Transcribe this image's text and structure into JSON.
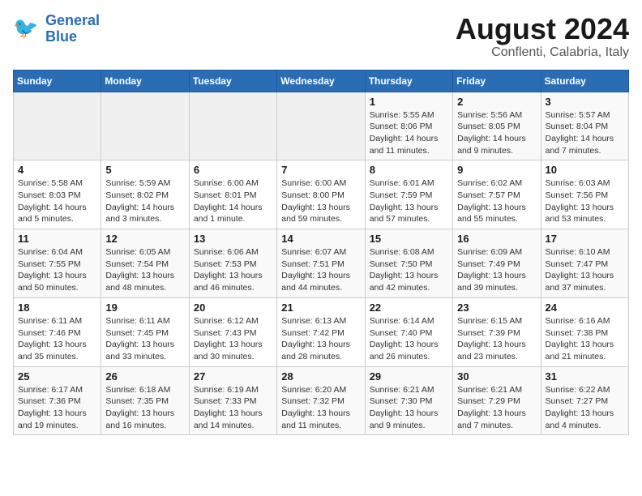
{
  "header": {
    "logo_line1": "General",
    "logo_line2": "Blue",
    "title": "August 2024",
    "subtitle": "Conflenti, Calabria, Italy"
  },
  "weekdays": [
    "Sunday",
    "Monday",
    "Tuesday",
    "Wednesday",
    "Thursday",
    "Friday",
    "Saturday"
  ],
  "weeks": [
    [
      {
        "day": "",
        "info": ""
      },
      {
        "day": "",
        "info": ""
      },
      {
        "day": "",
        "info": ""
      },
      {
        "day": "",
        "info": ""
      },
      {
        "day": "1",
        "info": "Sunrise: 5:55 AM\nSunset: 8:06 PM\nDaylight: 14 hours\nand 11 minutes."
      },
      {
        "day": "2",
        "info": "Sunrise: 5:56 AM\nSunset: 8:05 PM\nDaylight: 14 hours\nand 9 minutes."
      },
      {
        "day": "3",
        "info": "Sunrise: 5:57 AM\nSunset: 8:04 PM\nDaylight: 14 hours\nand 7 minutes."
      }
    ],
    [
      {
        "day": "4",
        "info": "Sunrise: 5:58 AM\nSunset: 8:03 PM\nDaylight: 14 hours\nand 5 minutes."
      },
      {
        "day": "5",
        "info": "Sunrise: 5:59 AM\nSunset: 8:02 PM\nDaylight: 14 hours\nand 3 minutes."
      },
      {
        "day": "6",
        "info": "Sunrise: 6:00 AM\nSunset: 8:01 PM\nDaylight: 14 hours\nand 1 minute."
      },
      {
        "day": "7",
        "info": "Sunrise: 6:00 AM\nSunset: 8:00 PM\nDaylight: 13 hours\nand 59 minutes."
      },
      {
        "day": "8",
        "info": "Sunrise: 6:01 AM\nSunset: 7:59 PM\nDaylight: 13 hours\nand 57 minutes."
      },
      {
        "day": "9",
        "info": "Sunrise: 6:02 AM\nSunset: 7:57 PM\nDaylight: 13 hours\nand 55 minutes."
      },
      {
        "day": "10",
        "info": "Sunrise: 6:03 AM\nSunset: 7:56 PM\nDaylight: 13 hours\nand 53 minutes."
      }
    ],
    [
      {
        "day": "11",
        "info": "Sunrise: 6:04 AM\nSunset: 7:55 PM\nDaylight: 13 hours\nand 50 minutes."
      },
      {
        "day": "12",
        "info": "Sunrise: 6:05 AM\nSunset: 7:54 PM\nDaylight: 13 hours\nand 48 minutes."
      },
      {
        "day": "13",
        "info": "Sunrise: 6:06 AM\nSunset: 7:53 PM\nDaylight: 13 hours\nand 46 minutes."
      },
      {
        "day": "14",
        "info": "Sunrise: 6:07 AM\nSunset: 7:51 PM\nDaylight: 13 hours\nand 44 minutes."
      },
      {
        "day": "15",
        "info": "Sunrise: 6:08 AM\nSunset: 7:50 PM\nDaylight: 13 hours\nand 42 minutes."
      },
      {
        "day": "16",
        "info": "Sunrise: 6:09 AM\nSunset: 7:49 PM\nDaylight: 13 hours\nand 39 minutes."
      },
      {
        "day": "17",
        "info": "Sunrise: 6:10 AM\nSunset: 7:47 PM\nDaylight: 13 hours\nand 37 minutes."
      }
    ],
    [
      {
        "day": "18",
        "info": "Sunrise: 6:11 AM\nSunset: 7:46 PM\nDaylight: 13 hours\nand 35 minutes."
      },
      {
        "day": "19",
        "info": "Sunrise: 6:11 AM\nSunset: 7:45 PM\nDaylight: 13 hours\nand 33 minutes."
      },
      {
        "day": "20",
        "info": "Sunrise: 6:12 AM\nSunset: 7:43 PM\nDaylight: 13 hours\nand 30 minutes."
      },
      {
        "day": "21",
        "info": "Sunrise: 6:13 AM\nSunset: 7:42 PM\nDaylight: 13 hours\nand 28 minutes."
      },
      {
        "day": "22",
        "info": "Sunrise: 6:14 AM\nSunset: 7:40 PM\nDaylight: 13 hours\nand 26 minutes."
      },
      {
        "day": "23",
        "info": "Sunrise: 6:15 AM\nSunset: 7:39 PM\nDaylight: 13 hours\nand 23 minutes."
      },
      {
        "day": "24",
        "info": "Sunrise: 6:16 AM\nSunset: 7:38 PM\nDaylight: 13 hours\nand 21 minutes."
      }
    ],
    [
      {
        "day": "25",
        "info": "Sunrise: 6:17 AM\nSunset: 7:36 PM\nDaylight: 13 hours\nand 19 minutes."
      },
      {
        "day": "26",
        "info": "Sunrise: 6:18 AM\nSunset: 7:35 PM\nDaylight: 13 hours\nand 16 minutes."
      },
      {
        "day": "27",
        "info": "Sunrise: 6:19 AM\nSunset: 7:33 PM\nDaylight: 13 hours\nand 14 minutes."
      },
      {
        "day": "28",
        "info": "Sunrise: 6:20 AM\nSunset: 7:32 PM\nDaylight: 13 hours\nand 11 minutes."
      },
      {
        "day": "29",
        "info": "Sunrise: 6:21 AM\nSunset: 7:30 PM\nDaylight: 13 hours\nand 9 minutes."
      },
      {
        "day": "30",
        "info": "Sunrise: 6:21 AM\nSunset: 7:29 PM\nDaylight: 13 hours\nand 7 minutes."
      },
      {
        "day": "31",
        "info": "Sunrise: 6:22 AM\nSunset: 7:27 PM\nDaylight: 13 hours\nand 4 minutes."
      }
    ]
  ]
}
